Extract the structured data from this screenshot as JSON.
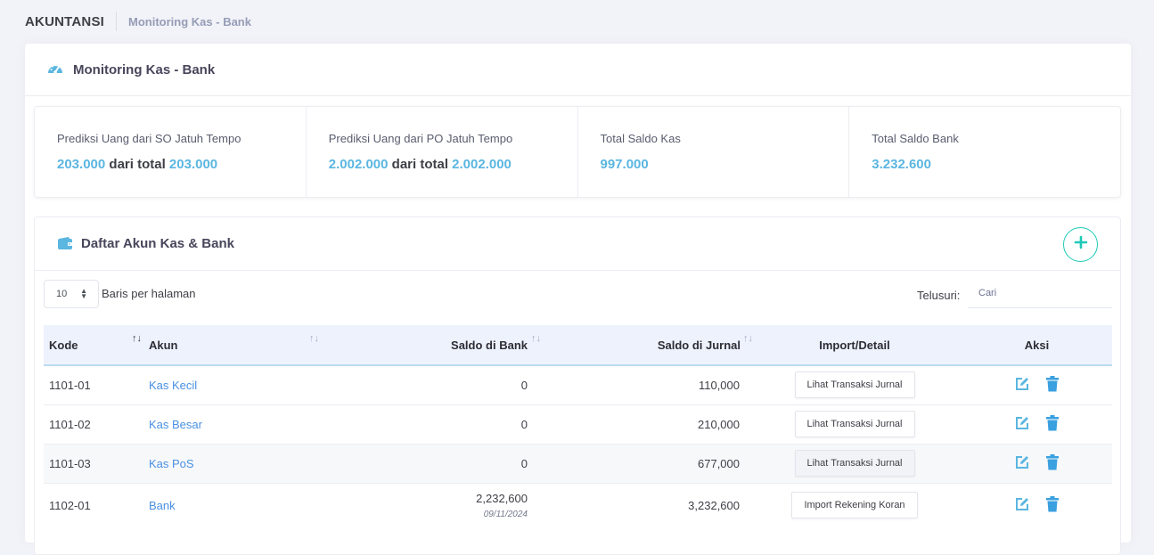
{
  "subheader": {
    "app_title": "AKUNTANSI",
    "breadcrumb": "Monitoring Kas - Bank"
  },
  "portlet": {
    "title": "Monitoring Kas - Bank",
    "icon": "speedometer-icon"
  },
  "stats": [
    {
      "label": "Prediksi Uang dari SO Jatuh Tempo",
      "value": "203.000",
      "connector": "dari total",
      "total": "203.000"
    },
    {
      "label": "Prediksi Uang dari PO Jatuh Tempo",
      "value": "2.002.000",
      "connector": "dari total",
      "total": "2.002.000"
    },
    {
      "label": "Total Saldo Kas",
      "value": "997.000"
    },
    {
      "label": "Total Saldo Bank",
      "value": "3.232.600"
    }
  ],
  "accounts_card": {
    "title": "Daftar Akun Kas & Bank",
    "icon": "wallet-icon",
    "add_icon": "plus-icon",
    "page_length": "10",
    "page_length_label": "Baris per halaman",
    "search_label": "Telusuri:",
    "search_placeholder": "Cari"
  },
  "table": {
    "headers": {
      "kode": "Kode",
      "akun": "Akun",
      "saldo_bank": "Saldo di Bank",
      "saldo_jurnal": "Saldo di Jurnal",
      "import": "Import/Detail",
      "aksi": "Aksi"
    },
    "rows": [
      {
        "kode": "1101-01",
        "akun": "Kas Kecil",
        "saldo_bank": "0",
        "saldo_bank_date": "",
        "saldo_jurnal": "110,000",
        "action": "Lihat Transaksi Jurnal"
      },
      {
        "kode": "1101-02",
        "akun": "Kas Besar",
        "saldo_bank": "0",
        "saldo_bank_date": "",
        "saldo_jurnal": "210,000",
        "action": "Lihat Transaksi Jurnal"
      },
      {
        "kode": "1101-03",
        "akun": "Kas PoS",
        "saldo_bank": "0",
        "saldo_bank_date": "",
        "saldo_jurnal": "677,000",
        "action": "Lihat Transaksi Jurnal"
      },
      {
        "kode": "1102-01",
        "akun": "Bank",
        "saldo_bank": "2,232,600",
        "saldo_bank_date": "09/11/2024",
        "saldo_jurnal": "3,232,600",
        "action": "Import Rekening Koran"
      }
    ]
  },
  "colors": {
    "accent": "#5bb6e0",
    "teal": "#1dc9b7",
    "edit": "#5bb6e0",
    "delete": "#3aa0e0"
  }
}
